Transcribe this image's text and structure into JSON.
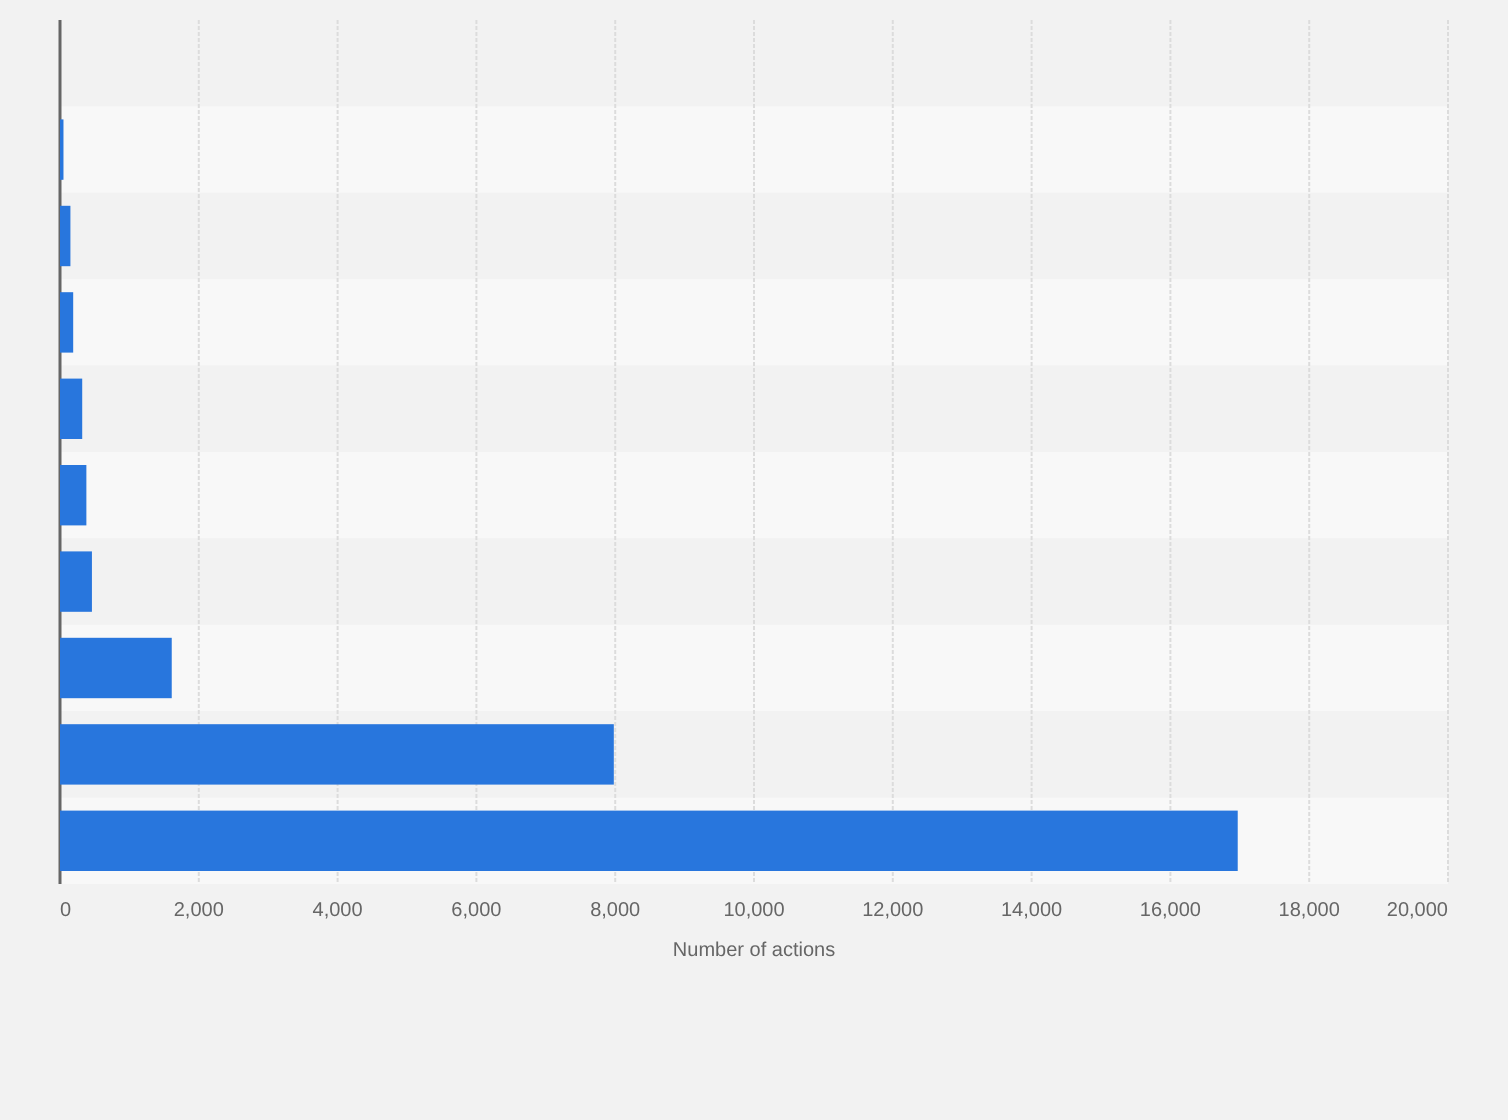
{
  "chart": {
    "chart_data": {
      "type": "bar",
      "orientation": "horizontal",
      "xlabel": "Number of actions",
      "grid": true,
      "values": [
        null,
        50,
        150,
        190,
        320,
        380,
        460,
        1610,
        7980,
        16970
      ],
      "xlim": [
        0,
        20000
      ],
      "xticks": [
        {
          "value": 0,
          "label": "0"
        },
        {
          "value": 2000,
          "label": "2,000"
        },
        {
          "value": 4000,
          "label": "4,000"
        },
        {
          "value": 6000,
          "label": "6,000"
        },
        {
          "value": 8000,
          "label": "8,000"
        },
        {
          "value": 10000,
          "label": "10,000"
        },
        {
          "value": 12000,
          "label": "12,000"
        },
        {
          "value": 14000,
          "label": "14,000"
        },
        {
          "value": 16000,
          "label": "16,000"
        },
        {
          "value": 18000,
          "label": "18,000"
        },
        {
          "value": 20000,
          "label": "20,000"
        }
      ]
    }
  }
}
